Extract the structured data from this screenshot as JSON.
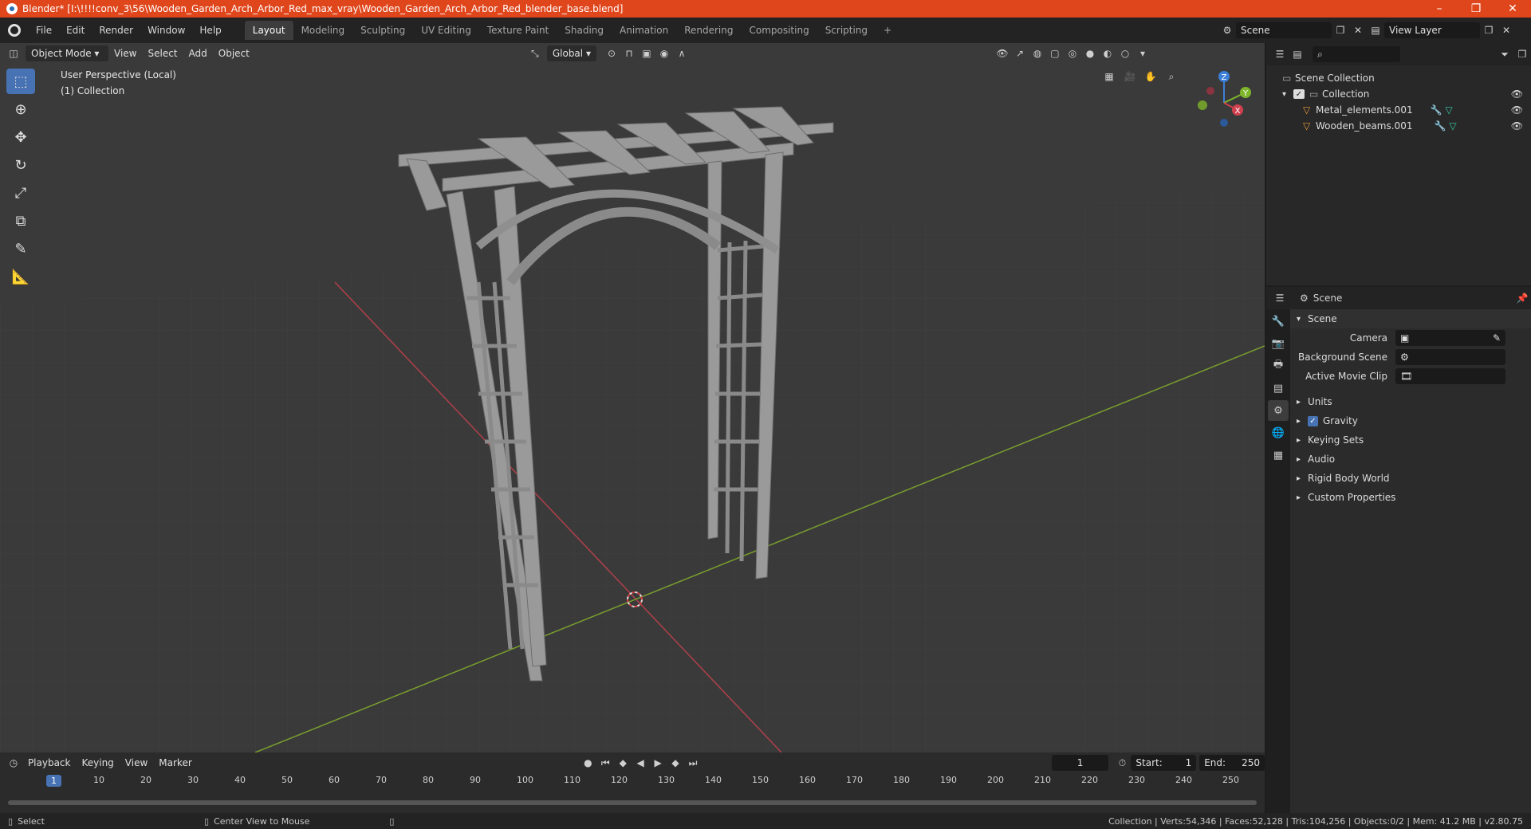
{
  "window": {
    "title": "Blender* [I:\\!!!!conv_3\\56\\Wooden_Garden_Arch_Arbor_Red_max_vray\\Wooden_Garden_Arch_Arbor_Red_blender_base.blend]",
    "minimize": "–",
    "restore": "❐",
    "close": "✕"
  },
  "menu": [
    "File",
    "Edit",
    "Render",
    "Window",
    "Help"
  ],
  "workspaces": [
    "Layout",
    "Modeling",
    "Sculpting",
    "UV Editing",
    "Texture Paint",
    "Shading",
    "Animation",
    "Rendering",
    "Compositing",
    "Scripting"
  ],
  "workspace_add": "+",
  "scene_field": "Scene",
  "view_layer_field": "View Layer",
  "viewport": {
    "mode": "Object Mode",
    "menus": [
      "View",
      "Select",
      "Add",
      "Object"
    ],
    "orientation": "Global",
    "perspective_label": "User Perspective (Local)",
    "collection_label": "(1) Collection",
    "gizmo": {
      "z": "Z",
      "y": "Y",
      "x": "X"
    }
  },
  "outliner": {
    "scene_collection": "Scene Collection",
    "collection": "Collection",
    "objects": [
      "Metal_elements.001",
      "Wooden_beams.001"
    ]
  },
  "properties": {
    "context": "Scene",
    "section": "Scene",
    "fields": {
      "camera": "Camera",
      "background_scene": "Background Scene",
      "active_movie_clip": "Active Movie Clip"
    },
    "subpanels": [
      "Units",
      "Gravity",
      "Keying Sets",
      "Audio",
      "Rigid Body World",
      "Custom Properties"
    ],
    "gravity_checked": true
  },
  "timeline": {
    "menus": [
      "Playback",
      "Keying",
      "View",
      "Marker"
    ],
    "current_frame": "1",
    "start_label": "Start:",
    "start": "1",
    "end_label": "End:",
    "end": "250",
    "ticks": [
      "1",
      "10",
      "20",
      "30",
      "40",
      "50",
      "60",
      "70",
      "80",
      "90",
      "100",
      "110",
      "120",
      "130",
      "140",
      "150",
      "160",
      "170",
      "180",
      "190",
      "200",
      "210",
      "220",
      "230",
      "240",
      "250"
    ]
  },
  "status": {
    "select": "Select",
    "center_view": "Center View to Mouse",
    "stats": "Collection | Verts:54,346 | Faces:52,128 | Tris:104,256 | Objects:0/2 | Mem: 41.2 MB | v2.80.75"
  },
  "colors": {
    "title_bar": "#e0461b",
    "accent": "#4772b3",
    "x_axis": "#d0404f",
    "y_axis": "#7fb52b",
    "z_axis": "#3c7fd8"
  }
}
